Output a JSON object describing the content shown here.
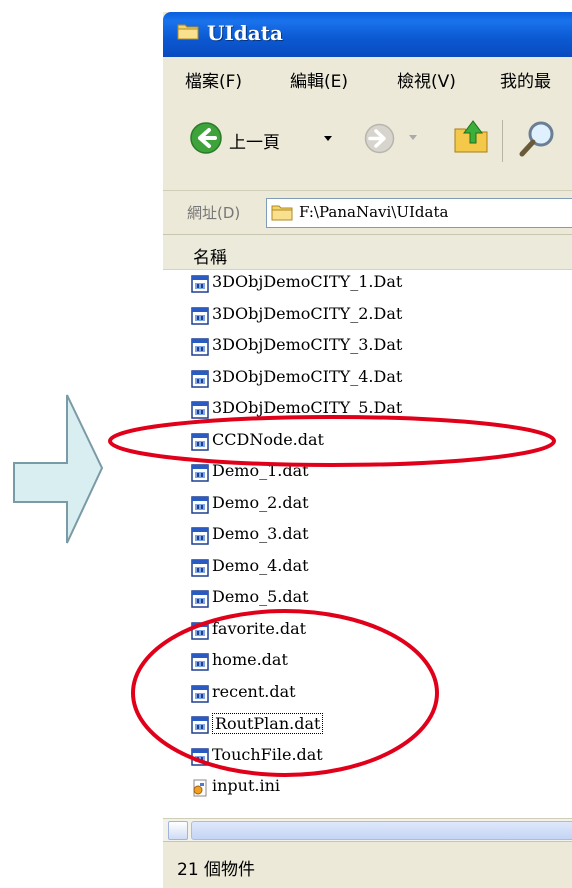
{
  "window": {
    "title": "UIdata"
  },
  "menu": {
    "items": [
      "檔案(F)",
      "編輯(E)",
      "檢視(V)",
      "我的最"
    ]
  },
  "toolbar": {
    "back_label": "上一頁"
  },
  "address": {
    "label": "網址(D)",
    "path": "F:\\PanaNavi\\UIdata"
  },
  "list": {
    "column_name": "名稱",
    "files": [
      "3DObjDemoCITY_1.Dat",
      "3DObjDemoCITY_2.Dat",
      "3DObjDemoCITY_3.Dat",
      "3DObjDemoCITY_4.Dat",
      "3DObjDemoCITY_5.Dat",
      "CCDNode.dat",
      "Demo_1.dat",
      "Demo_2.dat",
      "Demo_3.dat",
      "Demo_4.dat",
      "Demo_5.dat",
      "favorite.dat",
      "home.dat",
      "recent.dat",
      "RoutPlan.dat",
      "TouchFile.dat",
      "input.ini"
    ]
  },
  "status": {
    "text": "21 個物件"
  },
  "colors": {
    "title_bar": "#0a5fdc",
    "highlight_ellipse": "#e0001a",
    "arrow_fill": "#d9eef0",
    "arrow_stroke": "#7a9aa6"
  }
}
